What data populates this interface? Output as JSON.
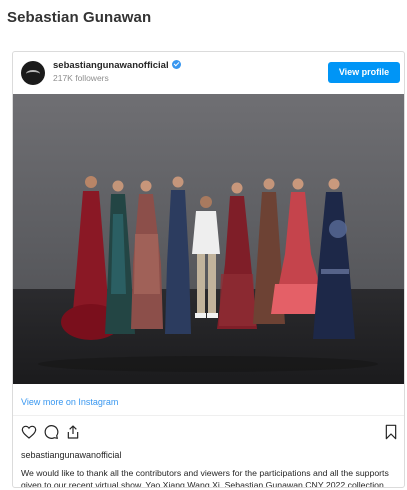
{
  "page": {
    "title": "Sebastian Gunawan"
  },
  "post": {
    "username": "sebastiangunawanofficial",
    "followers": "217K followers",
    "view_profile_label": "View profile",
    "view_more_label": "View more on Instagram",
    "caption_username": "sebastiangunawanofficial",
    "caption": "We would like to thank all the contributors and viewers for the participations and all the supports given to our recent virtual show, Yao Xiang Wang Xi, Sebastian Gunawan CNY 2022 collection."
  },
  "icons": [
    "instagram-avatar",
    "verified-badge-icon",
    "heart-icon",
    "comment-icon",
    "share-icon",
    "bookmark-icon"
  ],
  "colors": {
    "accent": "#0095f6",
    "link": "#3897f0",
    "text": "#262626",
    "muted": "#8e8e8e"
  }
}
